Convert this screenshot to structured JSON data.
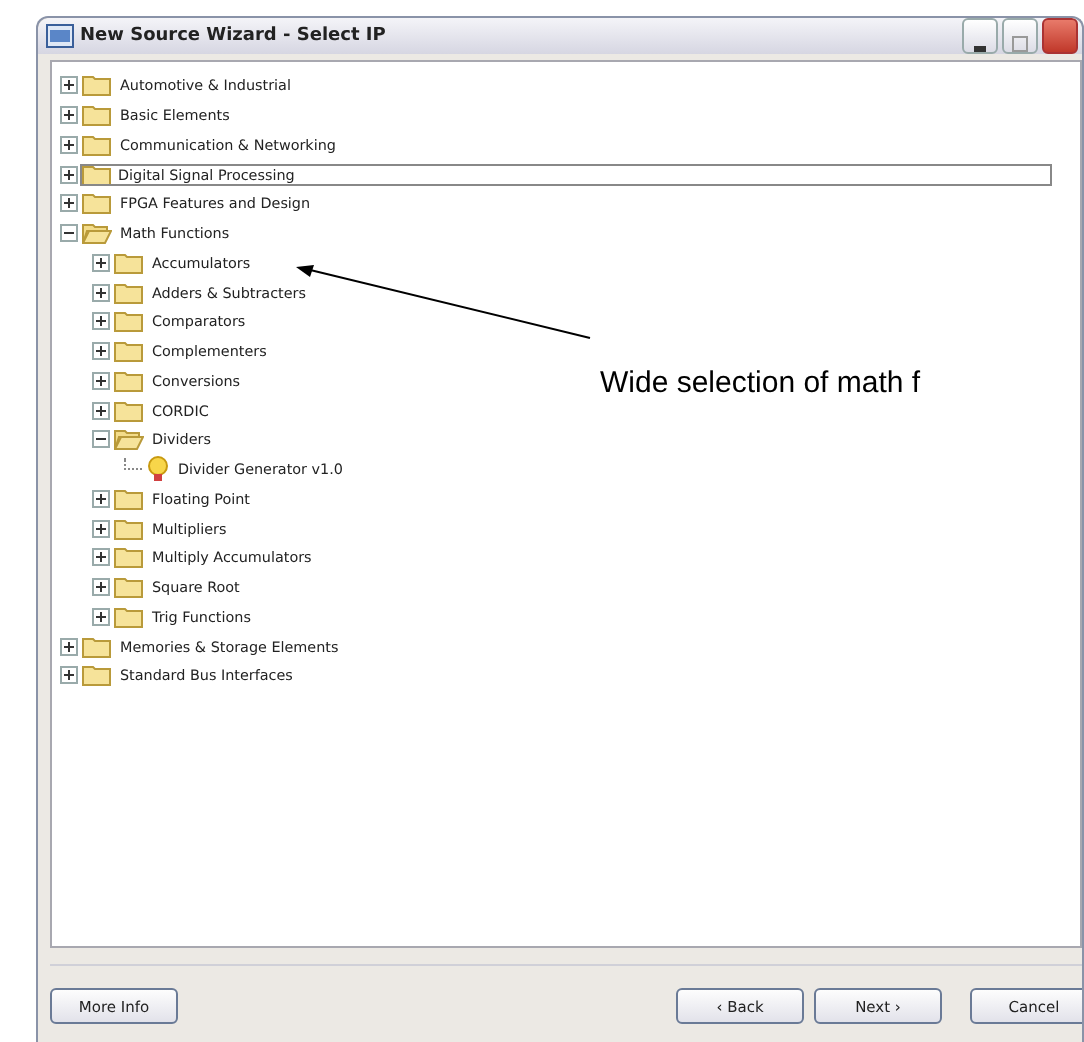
{
  "window": {
    "title": "New Source Wizard - Select IP"
  },
  "tree": [
    {
      "label": "Automotive & Industrial",
      "kind": "folder",
      "expanded": false,
      "selected": false
    },
    {
      "label": "Basic Elements",
      "kind": "folder",
      "expanded": false,
      "selected": false
    },
    {
      "label": "Communication & Networking",
      "kind": "folder",
      "expanded": false,
      "selected": false
    },
    {
      "label": "Digital Signal Processing",
      "kind": "folder",
      "expanded": false,
      "selected": true
    },
    {
      "label": "FPGA Features and Design",
      "kind": "folder",
      "expanded": false,
      "selected": false
    },
    {
      "label": "Math Functions",
      "kind": "folder",
      "expanded": true,
      "selected": false,
      "children": [
        {
          "label": "Accumulators",
          "kind": "folder",
          "expanded": false,
          "selected": false
        },
        {
          "label": "Adders & Subtracters",
          "kind": "folder",
          "expanded": false,
          "selected": false
        },
        {
          "label": "Comparators",
          "kind": "folder",
          "expanded": false,
          "selected": false
        },
        {
          "label": "Complementers",
          "kind": "folder",
          "expanded": false,
          "selected": false
        },
        {
          "label": "Conversions",
          "kind": "folder",
          "expanded": false,
          "selected": false
        },
        {
          "label": "CORDIC",
          "kind": "folder",
          "expanded": false,
          "selected": false
        },
        {
          "label": "Dividers",
          "kind": "folder",
          "expanded": true,
          "selected": false,
          "children": [
            {
              "label": "Divider Generator v1.0",
              "kind": "core",
              "selected": false
            }
          ]
        },
        {
          "label": "Floating Point",
          "kind": "folder",
          "expanded": false,
          "selected": false
        },
        {
          "label": "Multipliers",
          "kind": "folder",
          "expanded": false,
          "selected": false
        },
        {
          "label": "Multiply Accumulators",
          "kind": "folder",
          "expanded": false,
          "selected": false
        },
        {
          "label": "Square Root",
          "kind": "folder",
          "expanded": false,
          "selected": false
        },
        {
          "label": "Trig Functions",
          "kind": "folder",
          "expanded": false,
          "selected": false
        }
      ]
    },
    {
      "label": "Memories & Storage Elements",
      "kind": "folder",
      "expanded": false,
      "selected": false
    },
    {
      "label": "Standard Bus Interfaces",
      "kind": "folder",
      "expanded": false,
      "selected": false
    }
  ],
  "callout": {
    "text": "Wide selection of math f"
  },
  "buttons": {
    "left": [
      "More Info"
    ],
    "right": [
      "‹ Back",
      "Next ›",
      "Cancel"
    ]
  }
}
